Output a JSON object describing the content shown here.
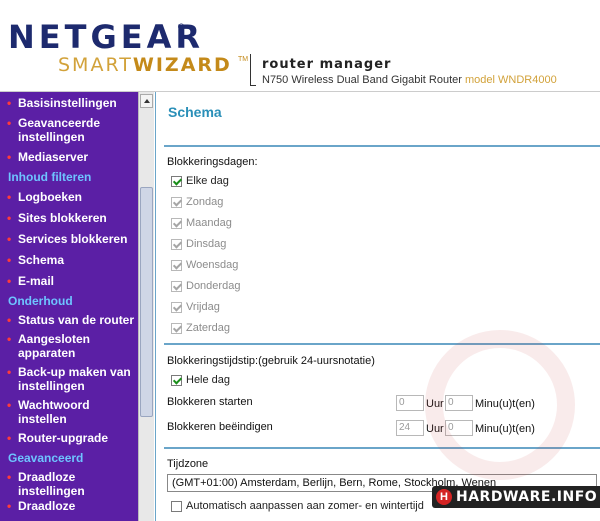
{
  "header": {
    "logo_main": "NETGEAR",
    "logo_reg": "®",
    "logo_smart": "SMART",
    "logo_wizard": "WIZARD",
    "logo_tm": "TM",
    "title": "router manager",
    "subtitle_prefix": "N750 Wireless Dual Band Gigabit Router",
    "subtitle_model": "model WNDR4000"
  },
  "sidebar": {
    "items": [
      {
        "type": "item",
        "label": "Basisinstellingen"
      },
      {
        "type": "item",
        "label": "Geavanceerde instellingen"
      },
      {
        "type": "item",
        "label": "Mediaserver"
      },
      {
        "type": "head",
        "label": "Inhoud filteren"
      },
      {
        "type": "item",
        "label": "Logboeken"
      },
      {
        "type": "item",
        "label": "Sites blokkeren"
      },
      {
        "type": "item",
        "label": "Services blokkeren"
      },
      {
        "type": "item",
        "label": "Schema"
      },
      {
        "type": "item",
        "label": "E-mail"
      },
      {
        "type": "head",
        "label": "Onderhoud"
      },
      {
        "type": "item",
        "label": "Status van de router"
      },
      {
        "type": "item",
        "label": "Aangesloten apparaten"
      },
      {
        "type": "item",
        "label": "Back-up maken van instellingen"
      },
      {
        "type": "item",
        "label": "Wachtwoord instellen"
      },
      {
        "type": "item",
        "label": "Router-upgrade"
      },
      {
        "type": "head",
        "label": "Geavanceerd"
      },
      {
        "type": "item",
        "label": "Draadloze instellingen"
      },
      {
        "type": "item",
        "label": "Draadloze"
      }
    ]
  },
  "main": {
    "title": "Schema",
    "days_label": "Blokkeringsdagen:",
    "every_day": {
      "label": "Elke dag",
      "checked": true
    },
    "days": [
      {
        "label": "Zondag",
        "checked": true
      },
      {
        "label": "Maandag",
        "checked": true
      },
      {
        "label": "Dinsdag",
        "checked": true
      },
      {
        "label": "Woensdag",
        "checked": true
      },
      {
        "label": "Donderdag",
        "checked": true
      },
      {
        "label": "Vrijdag",
        "checked": true
      },
      {
        "label": "Zaterdag",
        "checked": true
      }
    ],
    "time_label": "Blokkeringstijdstip:(gebruik 24-uursnotatie)",
    "all_day": {
      "label": "Hele dag",
      "checked": true
    },
    "start": {
      "label": "Blokkeren starten",
      "hour": "0",
      "minute": "0"
    },
    "end": {
      "label": "Blokkeren beëindigen",
      "hour": "24",
      "minute": "0"
    },
    "hour_unit": "Uur",
    "minute_unit": "Minu(u)t(en)",
    "timezone_label": "Tijdzone",
    "timezone_value": "(GMT+01:00) Amsterdam, Berlijn, Bern, Rome, Stockholm, Wenen",
    "dst": {
      "label": "Automatisch aanpassen aan zomer- en wintertijd",
      "checked": false
    }
  },
  "watermark": {
    "letter": "H",
    "text": "HARDWARE.INFO"
  }
}
